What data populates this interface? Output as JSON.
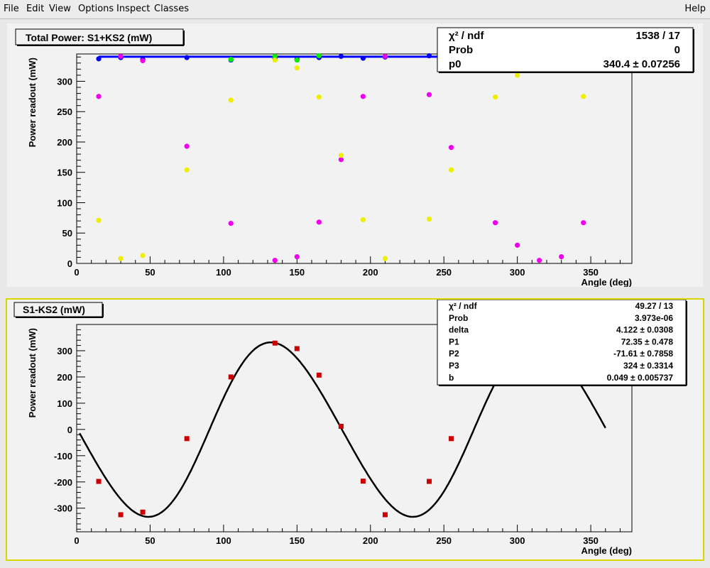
{
  "menu": {
    "file": "File",
    "edit": "Edit",
    "view": "View",
    "options": "Options",
    "inspect": "Inspect",
    "classes": "Classes",
    "help": "Help"
  },
  "colors": {
    "blue": "#0000ee",
    "green": "#00ee00",
    "magenta": "#ee00ee",
    "yellow": "#eeee00",
    "red": "#cc0000",
    "fit_blue": "#0000ff",
    "fit_black": "#000000"
  },
  "chart_data": [
    {
      "type": "scatter",
      "title": "Total Power: S1+KS2 (mW)",
      "xlabel": "Angle (deg)",
      "ylabel": "Power readout (mW)",
      "xlim": [
        0,
        378
      ],
      "ylim": [
        0,
        345
      ],
      "xticks": [
        0,
        50,
        100,
        150,
        200,
        250,
        300,
        350
      ],
      "yticks": [
        0,
        50,
        100,
        150,
        200,
        250,
        300
      ],
      "fit_line": {
        "y": 340.4,
        "x_range": [
          15,
          345
        ]
      },
      "series": [
        {
          "color": "blue",
          "points": [
            [
              15,
              337
            ],
            [
              30,
              339
            ],
            [
              45,
              336
            ],
            [
              75,
              339
            ],
            [
              105,
              335
            ],
            [
              135,
              338
            ],
            [
              150,
              336
            ],
            [
              165,
              339
            ],
            [
              180,
              341
            ],
            [
              195,
              338
            ],
            [
              210,
              340
            ],
            [
              240,
              342
            ],
            [
              255,
              342
            ]
          ]
        },
        {
          "color": "green",
          "points": [
            [
              105,
              336
            ],
            [
              135,
              341
            ],
            [
              150,
              335
            ],
            [
              165,
              342
            ],
            [
              285,
              342
            ],
            [
              300,
              341
            ],
            [
              315,
              342
            ],
            [
              330,
              339
            ],
            [
              345,
              343
            ]
          ]
        },
        {
          "color": "magenta",
          "points": [
            [
              15,
              275
            ],
            [
              30,
              341
            ],
            [
              45,
              334
            ],
            [
              75,
              193
            ],
            [
              105,
              66
            ],
            [
              135,
              5
            ],
            [
              150,
              11
            ],
            [
              165,
              68
            ],
            [
              180,
              171
            ],
            [
              195,
              275
            ],
            [
              210,
              341
            ],
            [
              240,
              278
            ],
            [
              255,
              191
            ],
            [
              285,
              67
            ],
            [
              300,
              30
            ],
            [
              315,
              5
            ],
            [
              330,
              11
            ],
            [
              345,
              67
            ]
          ]
        },
        {
          "color": "yellow",
          "points": [
            [
              15,
              71
            ],
            [
              30,
              8
            ],
            [
              45,
              13
            ],
            [
              75,
              154
            ],
            [
              105,
              269
            ],
            [
              135,
              335
            ],
            [
              150,
              322
            ],
            [
              165,
              274
            ],
            [
              180,
              178
            ],
            [
              195,
              72
            ],
            [
              210,
              8
            ],
            [
              240,
              73
            ],
            [
              255,
              154
            ],
            [
              285,
              274
            ],
            [
              300,
              310
            ],
            [
              315,
              336
            ],
            [
              330,
              326
            ],
            [
              345,
              275
            ]
          ]
        }
      ],
      "stats": [
        {
          "label": "χ² / ndf",
          "value": "1538 / 17"
        },
        {
          "label": "Prob",
          "value": "0"
        },
        {
          "label": "p0",
          "value": "340.4 ± 0.07256"
        }
      ]
    },
    {
      "type": "scatter",
      "title": "S1-KS2 (mW)",
      "xlabel": "Angle (deg)",
      "ylabel": "Power readout (mW)",
      "xlim": [
        0,
        378
      ],
      "ylim": [
        -390,
        400
      ],
      "xticks": [
        0,
        50,
        100,
        150,
        200,
        250,
        300,
        350
      ],
      "yticks": [
        -300,
        -200,
        -100,
        0,
        100,
        200,
        300
      ],
      "fit": {
        "delta": 4.122,
        "P1": 72.35,
        "P2": -71.61,
        "P3": 324,
        "b": 0.049,
        "x_range": [
          2,
          360
        ]
      },
      "series": [
        {
          "color": "red",
          "points": [
            [
              15,
              -198
            ],
            [
              30,
              -325
            ],
            [
              45,
              -315
            ],
            [
              75,
              -35
            ],
            [
              105,
              200
            ],
            [
              135,
              329
            ],
            [
              150,
              308
            ],
            [
              165,
              207
            ],
            [
              180,
              12
            ],
            [
              195,
              -197
            ],
            [
              210,
              -325
            ],
            [
              240,
              -198
            ],
            [
              255,
              -35
            ]
          ]
        }
      ],
      "stats": [
        {
          "label": "χ² / ndf",
          "value": "49.27 / 13"
        },
        {
          "label": "Prob",
          "value": "3.973e-06"
        },
        {
          "label": "delta",
          "value": "4.122 ± 0.0308"
        },
        {
          "label": "P1",
          "value": "72.35 ± 0.478"
        },
        {
          "label": "P2",
          "value": "-71.61 ± 0.7858"
        },
        {
          "label": "P3",
          "value": "324 ± 0.3314"
        },
        {
          "label": "b",
          "value": "0.049 ± 0.005737"
        }
      ]
    }
  ]
}
